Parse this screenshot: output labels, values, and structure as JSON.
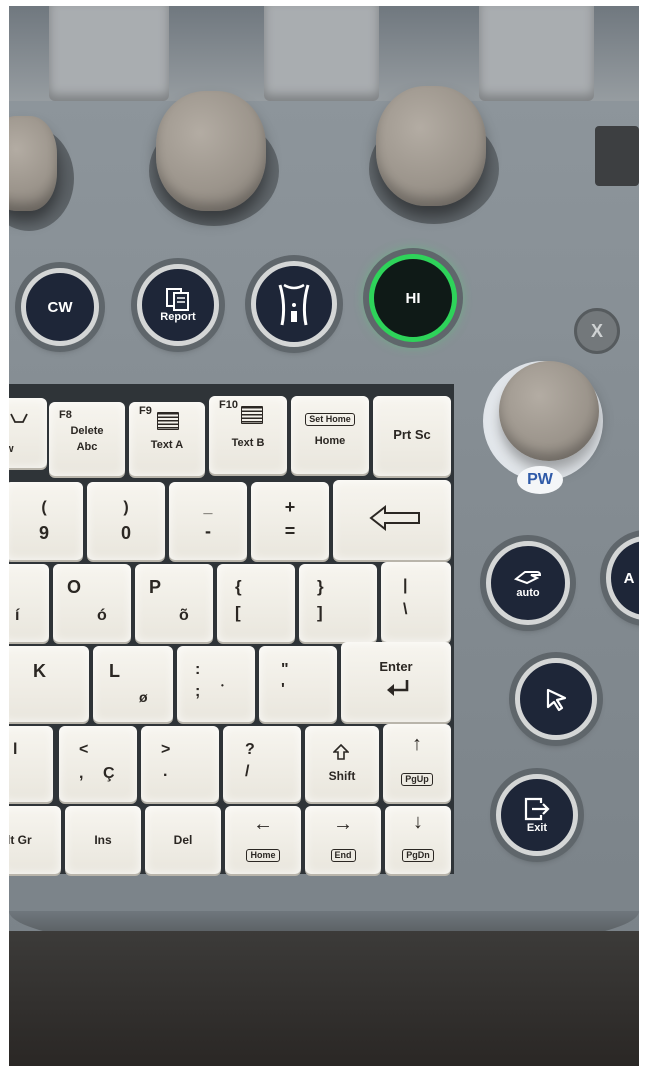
{
  "knobs": [
    "knob-left",
    "knob-center",
    "knob-right",
    "knob-pw"
  ],
  "buttons": {
    "cw": "CW",
    "report": "Report",
    "hi": "HI",
    "x": "X",
    "pw": "PW",
    "auto": "auto",
    "exit": "Exit",
    "edge": "A"
  },
  "colors": {
    "button_face": "#1e2638",
    "hi_ring": "#2ed35a",
    "pw_text": "#2f5aa8",
    "key_face": "#f2efe8"
  },
  "keys": {
    "row_f": {
      "partial_top": "",
      "partial_bottom": "w",
      "f8_fn": "F8",
      "f8_l1": "Delete",
      "f8_l2": "Abc",
      "f9_fn": "F9",
      "f9_label": "Text A",
      "f10_fn": "F10",
      "f10_label": "Text B",
      "home_box": "Set Home",
      "home_label": "Home",
      "prtsc": "Prt Sc"
    },
    "row_num": {
      "k9_top": "(",
      "k9_bottom": "9",
      "k0_top": ")",
      "k0_bottom": "0",
      "minus_top": "_",
      "minus_bottom": "-",
      "plus_top": "+",
      "plus_bottom": "="
    },
    "row_top": {
      "i_accent": "í",
      "o_main": "O",
      "o_accent": "ó",
      "p_main": "P",
      "p_accent": "õ",
      "brace_top": "{",
      "brace_bottom": "[",
      "brace_close_top": "}",
      "brace_close_bottom": "]",
      "pipe_top": "|",
      "pipe_bottom": "\\"
    },
    "row_home": {
      "k_main": "K",
      "l_main": "L",
      "l_accent": "ø",
      "semicolon_top": ":",
      "semicolon_bottom": ";",
      "semicolon_extra": "•",
      "quote_top": "\"",
      "quote_bottom": "'",
      "enter": "Enter"
    },
    "row_bottom": {
      "partial": "l",
      "comma_top": "<",
      "comma_bottom": ",",
      "comma_accent": "Ç",
      "period_top": ">",
      "period_bottom": ".",
      "slash_top": "?",
      "slash_bottom": "/",
      "shift": "Shift",
      "pgup_arrow": "↑",
      "pgup": "PgUp"
    },
    "row_nav": {
      "altgr": "lt Gr",
      "ins": "Ins",
      "del": "Del",
      "left_arrow": "←",
      "home": "Home",
      "right_arrow": "→",
      "end": "End",
      "down_arrow": "↓",
      "pgdn": "PgDn"
    }
  }
}
